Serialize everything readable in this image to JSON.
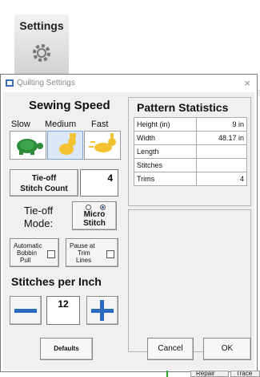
{
  "toolbar": {
    "settings_label": "Settings",
    "settings_icon": "gear-icon"
  },
  "dialog": {
    "title": "Quilting Settings",
    "close_glyph": "×",
    "sewing_speed": {
      "heading": "Sewing Speed",
      "options": [
        "Slow",
        "Medium",
        "Fast"
      ],
      "selected": "Medium"
    },
    "tieoff": {
      "button_label_line1": "Tie-off",
      "button_label_line2": "Stitch Count",
      "count": "4"
    },
    "tieoff_mode": {
      "label_line1": "Tie-off",
      "label_line2": "Mode:",
      "button_line1": "Micro",
      "button_line2": "Stitch"
    },
    "automatic_bobbin_pull": {
      "line1": "Automatic",
      "line2": "Bobbin",
      "line3": "Pull",
      "checked": false
    },
    "pause_at_trim_lines": {
      "line1": "Pause at",
      "line2": "Trim",
      "line3": "Lines",
      "checked": false
    },
    "stitches_per_inch": {
      "heading": "Stitches per Inch",
      "value": "12"
    },
    "pattern_statistics": {
      "heading": "Pattern Statistics",
      "rows": [
        {
          "label": "Height (in)",
          "value": "9 in"
        },
        {
          "label": "Width",
          "value": "48.17 in"
        },
        {
          "label": "Length",
          "value": ""
        },
        {
          "label": "Stitches",
          "value": ""
        },
        {
          "label": "Trims",
          "value": "4"
        }
      ]
    },
    "buttons": {
      "defaults": "Defaults",
      "cancel": "Cancel",
      "ok": "OK"
    }
  },
  "background": {
    "tab_repair": "Repair",
    "tab_trace": "Trace"
  },
  "colors": {
    "accent_blue": "#2c6bc0",
    "turtle_green": "#2e8b3a",
    "rabbit_yellow": "#f2c230"
  }
}
